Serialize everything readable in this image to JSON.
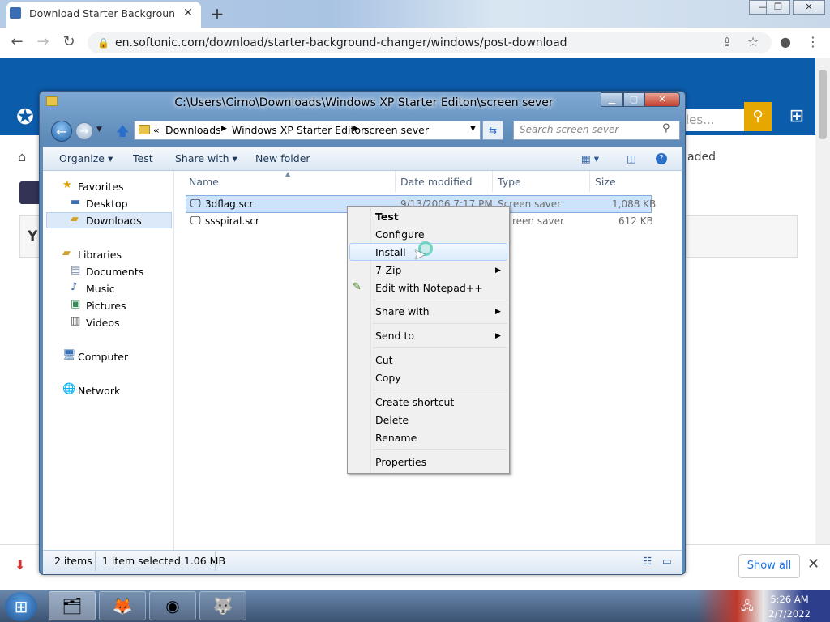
{
  "browser": {
    "tab_title": "Download Starter Background Ch",
    "url": "en.softonic.com/download/starter-background-changer/windows/post-download",
    "new_tab": "+",
    "tab_close": "✕"
  },
  "page": {
    "search_placeholder": "les...",
    "loaded_text": "aded",
    "card_text": "Y",
    "show_all": "Show all"
  },
  "explorer": {
    "title": "C:\\Users\\Cirno\\Downloads\\Windows XP Starter Editon\\screen sever",
    "breadcrumb": [
      "Downloads",
      "Windows XP Starter Editon",
      "screen sever"
    ],
    "breadcrumb_prefix": "«",
    "search_placeholder": "Search screen sever",
    "toolbar": {
      "organize": "Organize ▾",
      "test": "Test",
      "share_with": "Share with ▾",
      "new_folder": "New folder"
    },
    "nav": {
      "favorites": "Favorites",
      "desktop": "Desktop",
      "downloads": "Downloads",
      "libraries": "Libraries",
      "documents": "Documents",
      "music": "Music",
      "pictures": "Pictures",
      "videos": "Videos",
      "computer": "Computer",
      "network": "Network"
    },
    "columns": [
      "Name",
      "Date modified",
      "Type",
      "Size"
    ],
    "files": [
      {
        "name": "3dflag.scr",
        "date": "9/13/2006 7:17 PM",
        "type": "Screen saver",
        "size": "1,088 KB"
      },
      {
        "name": "ssspiral.scr",
        "date": "",
        "type": "reen saver",
        "size": "612 KB"
      }
    ],
    "status": {
      "count": "2 items",
      "selected": "1 item selected  1.06 MB"
    }
  },
  "context_menu": {
    "items": [
      "Test",
      "Configure",
      "Install",
      "7-Zip",
      "Edit with Notepad++",
      "Share with",
      "Send to",
      "Cut",
      "Copy",
      "Create shortcut",
      "Delete",
      "Rename",
      "Properties"
    ]
  },
  "taskbar": {
    "time": "5:26 AM",
    "date": "2/7/2022"
  },
  "colors": {
    "softonic_blue": "#0b5cab",
    "search_button": "#e6a800",
    "selection": "#cce3fb"
  }
}
